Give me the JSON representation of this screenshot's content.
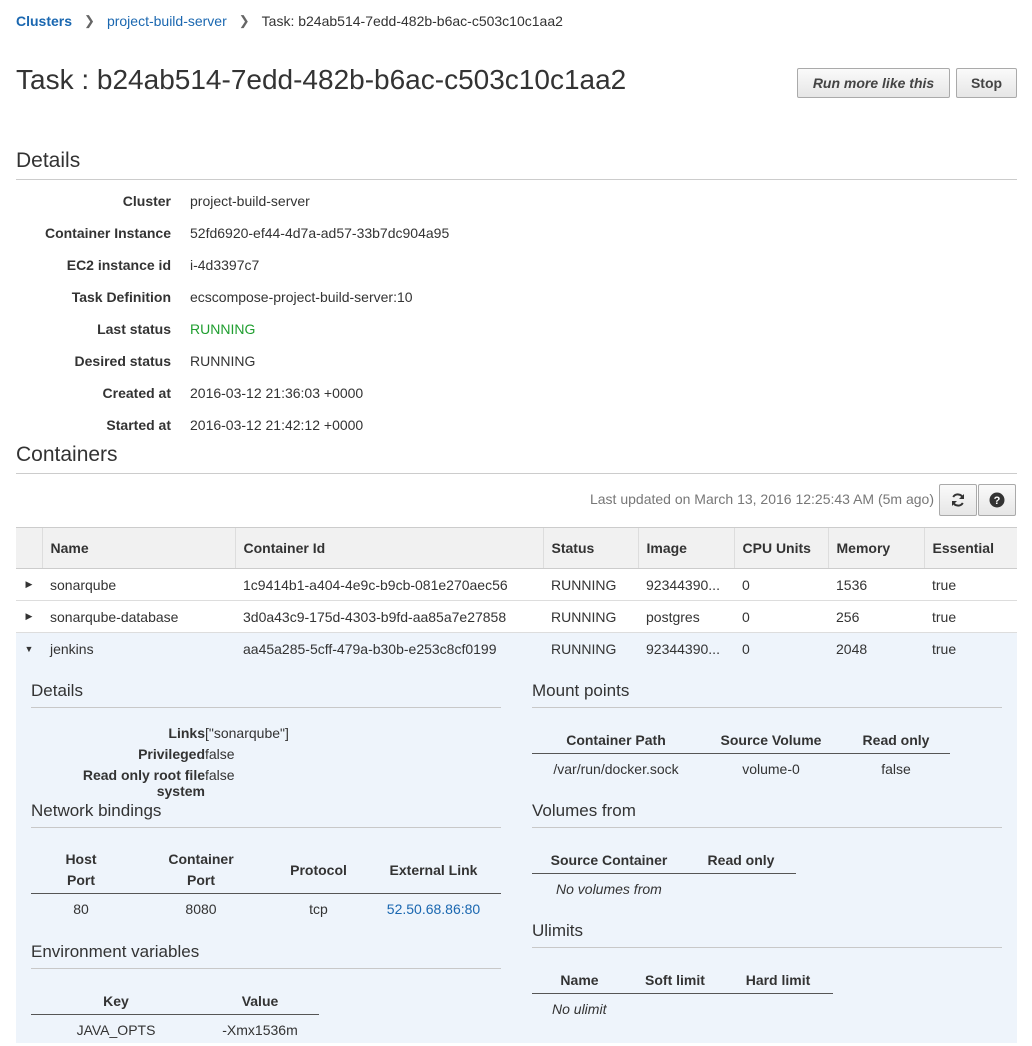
{
  "breadcrumb": {
    "home": "Clusters",
    "cluster": "project-build-server",
    "current": "Task: b24ab514-7edd-482b-b6ac-c503c10c1aa2"
  },
  "page_title": "Task : b24ab514-7edd-482b-b6ac-c503c10c1aa2",
  "actions": {
    "run_more": "Run more like this",
    "stop": "Stop"
  },
  "details": {
    "heading": "Details",
    "rows": [
      {
        "label": "Cluster",
        "value": "project-build-server"
      },
      {
        "label": "Container Instance",
        "value": "52fd6920-ef44-4d7a-ad57-33b7dc904a95"
      },
      {
        "label": "EC2 instance id",
        "value": "i-4d3397c7"
      },
      {
        "label": "Task Definition",
        "value": "ecscompose-project-build-server:10"
      },
      {
        "label": "Last status",
        "value": "RUNNING"
      },
      {
        "label": "Desired status",
        "value": "RUNNING"
      },
      {
        "label": "Created at",
        "value": "2016-03-12 21:36:03 +0000"
      },
      {
        "label": "Started at",
        "value": "2016-03-12 21:42:12 +0000"
      }
    ]
  },
  "containers": {
    "heading": "Containers",
    "last_updated": "Last updated on March 13, 2016 12:25:43 AM (5m ago)",
    "refresh_icon": "refresh-icon",
    "help_icon": "help-icon",
    "columns": [
      "Name",
      "Container Id",
      "Status",
      "Image",
      "CPU Units",
      "Memory",
      "Essential"
    ],
    "rows": [
      {
        "name": "sonarqube",
        "id": "1c9414b1-a404-4e9c-b9cb-081e270aec56",
        "status": "RUNNING",
        "image": "92344390...",
        "cpu": "0",
        "memory": "1536",
        "essential": "true"
      },
      {
        "name": "sonarqube-database",
        "id": "3d0a43c9-175d-4303-b9fd-aa85a7e27858",
        "status": "RUNNING",
        "image": "postgres",
        "cpu": "0",
        "memory": "256",
        "essential": "true"
      },
      {
        "name": "jenkins",
        "id": "aa45a285-5cff-479a-b30b-e253c8cf0199",
        "status": "RUNNING",
        "image": "92344390...",
        "cpu": "0",
        "memory": "2048",
        "essential": "true"
      }
    ],
    "status_color": "#1f9e2f"
  },
  "expanded": {
    "details": {
      "heading": "Details",
      "rows": [
        {
          "label": "Links",
          "value": "[\"sonarqube\"]"
        },
        {
          "label": "Privileged",
          "value": "false"
        },
        {
          "label": "Read only root file system",
          "value": "false"
        }
      ]
    },
    "network": {
      "heading": "Network bindings",
      "columns": {
        "host_1": "Host",
        "host_2": "Port",
        "container_1": "Container",
        "container_2": "Port",
        "protocol": "Protocol",
        "link": "External Link"
      },
      "rows": [
        {
          "host": "80",
          "container": "8080",
          "protocol": "tcp",
          "link": "52.50.68.86:80"
        }
      ]
    },
    "env": {
      "heading": "Environment variables",
      "columns": {
        "key": "Key",
        "value": "Value"
      },
      "rows": [
        {
          "key": "JAVA_OPTS",
          "value": "-Xmx1536m"
        }
      ]
    },
    "mounts": {
      "heading": "Mount points",
      "columns": {
        "path": "Container Path",
        "source": "Source Volume",
        "readonly": "Read only"
      },
      "rows": [
        {
          "path": "/var/run/docker.sock",
          "source": "volume-0",
          "readonly": "false"
        }
      ]
    },
    "volumes_from": {
      "heading": "Volumes from",
      "columns": {
        "source": "Source Container",
        "readonly": "Read only"
      },
      "empty": "No volumes from"
    },
    "ulimits": {
      "heading": "Ulimits",
      "columns": {
        "name": "Name",
        "soft": "Soft limit",
        "hard": "Hard limit"
      },
      "empty": "No ulimit"
    }
  }
}
